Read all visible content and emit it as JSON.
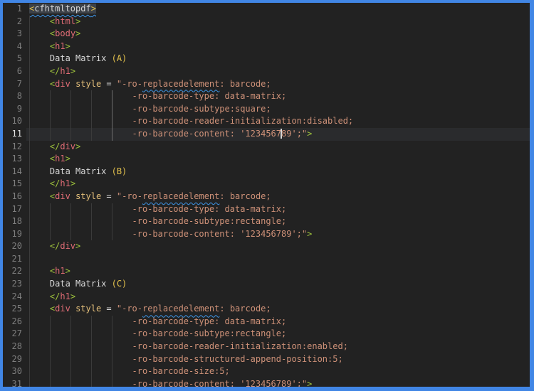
{
  "colors": {
    "border-blue": "#4186e5",
    "editor-bg": "#222222",
    "current-line-bg": "#2a2b2d",
    "gutter-fg": "#7e7e7e",
    "gutter-active-fg": "#e3e3e3",
    "token-tag": "#e06c75",
    "token-punct": "#9fc33c",
    "token-attr": "#e5c07b",
    "token-text": "#d8d8d8",
    "token-string": "#ce9178",
    "token-gold": "#e2c04c",
    "squiggle-blue": "#3e96e8",
    "highlight-box-bg": "#3c4148",
    "indent-guide": "#3b3b3b",
    "indent-guide-active": "#6e6e6e",
    "cursor": "#d8d8d8"
  },
  "editor": {
    "cursor_line": 11,
    "active_indent_guide": {
      "from_line": 8,
      "to_line": 11,
      "column": 16
    },
    "lines": [
      {
        "num": "1",
        "segments": [
          {
            "c": "gold hl",
            "t": "<"
          },
          {
            "c": "txt hl",
            "t": "cfhtmltopdf"
          },
          {
            "c": "gold hl",
            "t": ">"
          }
        ]
      },
      {
        "num": "2",
        "segments": [
          {
            "c": "txt",
            "t": "    "
          },
          {
            "c": "pun",
            "t": "<"
          },
          {
            "c": "tag",
            "t": "html"
          },
          {
            "c": "pun",
            "t": ">"
          }
        ]
      },
      {
        "num": "3",
        "segments": [
          {
            "c": "txt",
            "t": "    "
          },
          {
            "c": "pun",
            "t": "<"
          },
          {
            "c": "tag",
            "t": "body"
          },
          {
            "c": "pun",
            "t": ">"
          }
        ]
      },
      {
        "num": "4",
        "segments": [
          {
            "c": "txt",
            "t": "    "
          },
          {
            "c": "pun",
            "t": "<"
          },
          {
            "c": "tag",
            "t": "h1"
          },
          {
            "c": "pun",
            "t": ">"
          }
        ]
      },
      {
        "num": "5",
        "segments": [
          {
            "c": "txt",
            "t": "    Data Matrix "
          },
          {
            "c": "gold",
            "t": "(A)"
          }
        ]
      },
      {
        "num": "6",
        "segments": [
          {
            "c": "txt",
            "t": "    "
          },
          {
            "c": "pun",
            "t": "</"
          },
          {
            "c": "tag",
            "t": "h1"
          },
          {
            "c": "pun",
            "t": ">"
          }
        ]
      },
      {
        "num": "7",
        "segments": [
          {
            "c": "txt",
            "t": "    "
          },
          {
            "c": "pun",
            "t": "<"
          },
          {
            "c": "tag",
            "t": "div"
          },
          {
            "c": "txt",
            "t": " "
          },
          {
            "c": "attr",
            "t": "style"
          },
          {
            "c": "txt",
            "t": " = "
          },
          {
            "c": "str",
            "t": "\"-ro-"
          },
          {
            "c": "str wavy",
            "t": "replacedelement"
          },
          {
            "c": "str",
            "t": ": barcode;"
          }
        ]
      },
      {
        "num": "8",
        "segments": [
          {
            "c": "str",
            "t": "                    -ro-barcode-type: data-matrix;"
          }
        ]
      },
      {
        "num": "9",
        "segments": [
          {
            "c": "str",
            "t": "                    -ro-barcode-subtype:square;"
          }
        ]
      },
      {
        "num": "10",
        "segments": [
          {
            "c": "str",
            "t": "                    -ro-barcode-reader-initialization:disabled;"
          }
        ]
      },
      {
        "num": "11",
        "segments": [
          {
            "c": "str",
            "t": "                    -ro-barcode-content: '1234567"
          },
          {
            "cursor": true
          },
          {
            "c": "str",
            "t": "89';\""
          },
          {
            "c": "pun",
            "t": ">"
          }
        ]
      },
      {
        "num": "12",
        "segments": [
          {
            "c": "txt",
            "t": "    "
          },
          {
            "c": "pun",
            "t": "</"
          },
          {
            "c": "tag",
            "t": "div"
          },
          {
            "c": "pun",
            "t": ">"
          }
        ]
      },
      {
        "num": "13",
        "segments": [
          {
            "c": "txt",
            "t": "    "
          },
          {
            "c": "pun",
            "t": "<"
          },
          {
            "c": "tag",
            "t": "h1"
          },
          {
            "c": "pun",
            "t": ">"
          }
        ]
      },
      {
        "num": "14",
        "segments": [
          {
            "c": "txt",
            "t": "    Data Matrix "
          },
          {
            "c": "gold",
            "t": "(B)"
          }
        ]
      },
      {
        "num": "15",
        "segments": [
          {
            "c": "txt",
            "t": "    "
          },
          {
            "c": "pun",
            "t": "</"
          },
          {
            "c": "tag",
            "t": "h1"
          },
          {
            "c": "pun",
            "t": ">"
          }
        ]
      },
      {
        "num": "16",
        "segments": [
          {
            "c": "txt",
            "t": "    "
          },
          {
            "c": "pun",
            "t": "<"
          },
          {
            "c": "tag",
            "t": "div"
          },
          {
            "c": "txt",
            "t": " "
          },
          {
            "c": "attr",
            "t": "style"
          },
          {
            "c": "txt",
            "t": " = "
          },
          {
            "c": "str",
            "t": "\"-ro-"
          },
          {
            "c": "str wavy",
            "t": "replacedelement"
          },
          {
            "c": "str",
            "t": ": barcode;"
          }
        ]
      },
      {
        "num": "17",
        "segments": [
          {
            "c": "str",
            "t": "                    -ro-barcode-type: data-matrix;"
          }
        ]
      },
      {
        "num": "18",
        "segments": [
          {
            "c": "str",
            "t": "                    -ro-barcode-subtype:rectangle;"
          }
        ]
      },
      {
        "num": "19",
        "segments": [
          {
            "c": "str",
            "t": "                    -ro-barcode-content: '123456789';\""
          },
          {
            "c": "pun",
            "t": ">"
          }
        ]
      },
      {
        "num": "20",
        "segments": [
          {
            "c": "txt",
            "t": "    "
          },
          {
            "c": "pun",
            "t": "</"
          },
          {
            "c": "tag",
            "t": "div"
          },
          {
            "c": "pun",
            "t": ">"
          }
        ]
      },
      {
        "num": "21",
        "segments": []
      },
      {
        "num": "22",
        "segments": [
          {
            "c": "txt",
            "t": "    "
          },
          {
            "c": "pun",
            "t": "<"
          },
          {
            "c": "tag",
            "t": "h1"
          },
          {
            "c": "pun",
            "t": ">"
          }
        ]
      },
      {
        "num": "23",
        "segments": [
          {
            "c": "txt",
            "t": "    Data Matrix "
          },
          {
            "c": "gold",
            "t": "(C)"
          }
        ]
      },
      {
        "num": "24",
        "segments": [
          {
            "c": "txt",
            "t": "    "
          },
          {
            "c": "pun",
            "t": "</"
          },
          {
            "c": "tag",
            "t": "h1"
          },
          {
            "c": "pun",
            "t": ">"
          }
        ]
      },
      {
        "num": "25",
        "segments": [
          {
            "c": "txt",
            "t": "    "
          },
          {
            "c": "pun",
            "t": "<"
          },
          {
            "c": "tag",
            "t": "div"
          },
          {
            "c": "txt",
            "t": " "
          },
          {
            "c": "attr",
            "t": "style"
          },
          {
            "c": "txt",
            "t": " = "
          },
          {
            "c": "str",
            "t": "\"-ro-"
          },
          {
            "c": "str wavy",
            "t": "replacedelement"
          },
          {
            "c": "str",
            "t": ": barcode;"
          }
        ]
      },
      {
        "num": "26",
        "segments": [
          {
            "c": "str",
            "t": "                    -ro-barcode-type: data-matrix;"
          }
        ]
      },
      {
        "num": "27",
        "segments": [
          {
            "c": "str",
            "t": "                    -ro-barcode-subtype:rectangle;"
          }
        ]
      },
      {
        "num": "28",
        "segments": [
          {
            "c": "str",
            "t": "                    -ro-barcode-reader-initialization:enabled;"
          }
        ]
      },
      {
        "num": "29",
        "segments": [
          {
            "c": "str",
            "t": "                    -ro-barcode-structured-append-position:5;"
          }
        ]
      },
      {
        "num": "30",
        "segments": [
          {
            "c": "str",
            "t": "                    -ro-barcode-size:5;"
          }
        ]
      },
      {
        "num": "31",
        "segments": [
          {
            "c": "str",
            "t": "                    -ro-barcode-content: '123456789';\""
          },
          {
            "c": "pun",
            "t": ">"
          }
        ]
      }
    ]
  }
}
